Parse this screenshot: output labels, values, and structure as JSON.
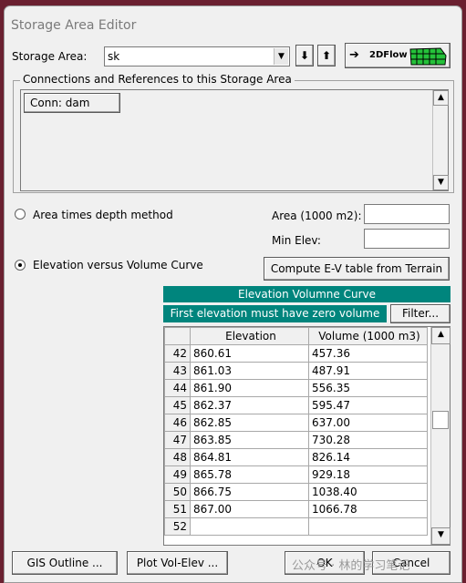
{
  "window": {
    "title": "Storage Area Editor"
  },
  "storage_area": {
    "label": "Storage Area:",
    "value": "sk",
    "flow_button_label": "2DFlow"
  },
  "connections": {
    "group_label": "Connections and References to this Storage Area",
    "items": [
      "Conn: dam"
    ]
  },
  "methods": {
    "area_depth_label": "Area times depth method",
    "area_depth_selected": false,
    "area_label": "Area (1000 m2):",
    "area_value": "",
    "min_elev_label": "Min Elev:",
    "min_elev_value": "",
    "elev_vol_label": "Elevation versus Volume Curve",
    "elev_vol_selected": true,
    "compute_button": "Compute E-V table from Terrain"
  },
  "curve": {
    "title": "Elevation Volumne Curve",
    "note": "First elevation must have zero volume",
    "filter_button": "Filter...",
    "headers": [
      "Elevation",
      "Volume (1000 m3)"
    ],
    "rows": [
      {
        "n": "42",
        "elev": "860.61",
        "vol": "457.36"
      },
      {
        "n": "43",
        "elev": "861.03",
        "vol": "487.91"
      },
      {
        "n": "44",
        "elev": "861.90",
        "vol": "556.35"
      },
      {
        "n": "45",
        "elev": "862.37",
        "vol": "595.47"
      },
      {
        "n": "46",
        "elev": "862.85",
        "vol": "637.00"
      },
      {
        "n": "47",
        "elev": "863.85",
        "vol": "730.28"
      },
      {
        "n": "48",
        "elev": "864.81",
        "vol": "826.14"
      },
      {
        "n": "49",
        "elev": "865.78",
        "vol": "929.18"
      },
      {
        "n": "50",
        "elev": "866.75",
        "vol": "1038.40"
      },
      {
        "n": "51",
        "elev": "867.00",
        "vol": "1066.78"
      },
      {
        "n": "52",
        "elev": "",
        "vol": ""
      }
    ]
  },
  "footer": {
    "gis_button": "GIS Outline ...",
    "plot_button": "Plot Vol-Elev ...",
    "ok_button": "OK",
    "cancel_button": "Cancel",
    "watermark": "公众号 · 林的学习笔记"
  },
  "colors": {
    "accent": "#00857d",
    "backdrop": "#6a2030"
  }
}
